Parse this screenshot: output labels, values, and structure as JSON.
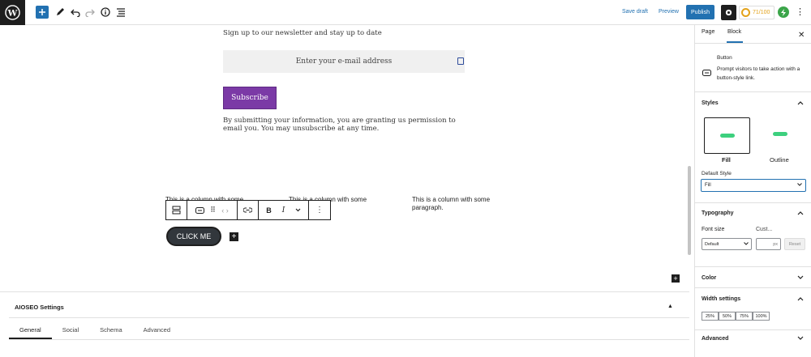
{
  "topbar": {
    "save_draft": "Save draft",
    "preview": "Preview",
    "publish": "Publish",
    "score": "71/100"
  },
  "content": {
    "newsletter_title": "Sign up to our newsletter and stay up to date",
    "email_placeholder": "Enter your e-mail address",
    "subscribe_label": "Subscribe",
    "consent_text": "By submitting your information, you are granting us permission to email you. You may unsubscribe at any time.",
    "columns": [
      "This is a column with some paragraph.",
      "This is a column with some",
      "This is a column with some paragraph."
    ],
    "button_label": "CLICK ME"
  },
  "aioseo": {
    "title": "AIOSEO Settings",
    "tabs": [
      "General",
      "Social",
      "Schema",
      "Advanced"
    ]
  },
  "sidebar": {
    "tabs": [
      "Page",
      "Block"
    ],
    "block_name": "Button",
    "block_desc": "Prompt visitors to take action with a button-style link.",
    "styles_title": "Styles",
    "style_fill": "Fill",
    "style_outline": "Outline",
    "default_style_label": "Default Style",
    "default_style_value": "Fill",
    "typography_title": "Typography",
    "font_size_label": "Font size",
    "custom_label": "Cust...",
    "font_size_value": "Default",
    "px_unit": "px",
    "reset": "Reset",
    "color_title": "Color",
    "width_title": "Width settings",
    "widths": [
      "25%",
      "50%",
      "75%",
      "100%"
    ],
    "advanced_title": "Advanced"
  },
  "colors": {
    "accent": "#2271b1",
    "subscribe_bg": "#7b3aa6",
    "button_bg": "#32373c",
    "fill_preview": "#3dd07e"
  }
}
